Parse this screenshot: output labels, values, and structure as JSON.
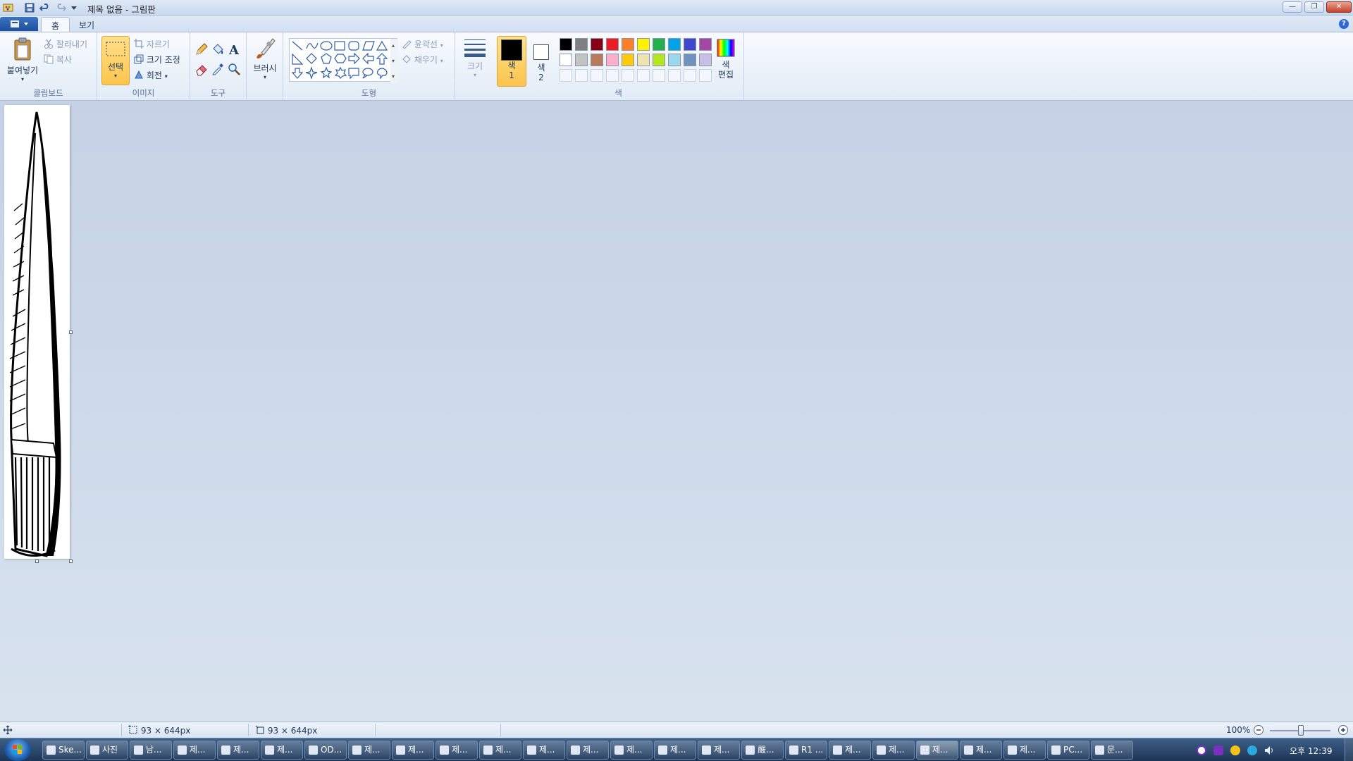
{
  "window": {
    "title": "제목 없음 - 그림판",
    "controls": {
      "minimize": "—",
      "restore": "❐",
      "close": "✕"
    }
  },
  "tabs": [
    {
      "label": "홈",
      "active": true
    },
    {
      "label": "보기",
      "active": false
    }
  ],
  "help": "?",
  "ribbon": {
    "clipboard": {
      "label": "클립보드",
      "paste": "붙여넣기",
      "cut": "잘라내기",
      "copy": "복사"
    },
    "image": {
      "label": "이미지",
      "select": "선택",
      "crop": "자르기",
      "resize": "크기 조정",
      "rotate": "회전"
    },
    "tools": {
      "label": "도구"
    },
    "brush": {
      "label": "브러시"
    },
    "shapes": {
      "label": "도형",
      "outline": "윤곽선",
      "fill": "채우기"
    },
    "size": {
      "label": "크기"
    },
    "colors": {
      "label": "색",
      "color1": "색\n1",
      "color1_line1": "색",
      "color1_line2": "1",
      "color2_line1": "색",
      "color2_line2": "2",
      "edit_line1": "색",
      "edit_line2": "편집",
      "color1_value": "#000000",
      "color2_value": "#ffffff",
      "palette_row1": [
        "#000000",
        "#7f7f7f",
        "#880015",
        "#ed1c24",
        "#ff7f27",
        "#fff200",
        "#22b14c",
        "#00a2e8",
        "#3f48cc",
        "#a349a4"
      ],
      "palette_row2": [
        "#ffffff",
        "#c3c3c3",
        "#b97a57",
        "#ffaec9",
        "#ffc90e",
        "#efe4b0",
        "#b5e61d",
        "#99d9ea",
        "#7092be",
        "#c8bfe7"
      ]
    }
  },
  "statusbar": {
    "canvas_size": "93 × 644px",
    "selection_size": "93 × 644px",
    "zoom": "100%"
  },
  "taskbar": {
    "items": [
      "Ske...",
      "사진",
      "남...",
      "제...",
      "제...",
      "제...",
      "OD...",
      "제...",
      "제...",
      "제...",
      "제...",
      "제...",
      "제...",
      "제...",
      "제...",
      "제...",
      "嚴...",
      "R1 ...",
      "제...",
      "제...",
      "제...",
      "제...",
      "제...",
      "PC...",
      "문..."
    ],
    "clock": "오후 12:39"
  }
}
